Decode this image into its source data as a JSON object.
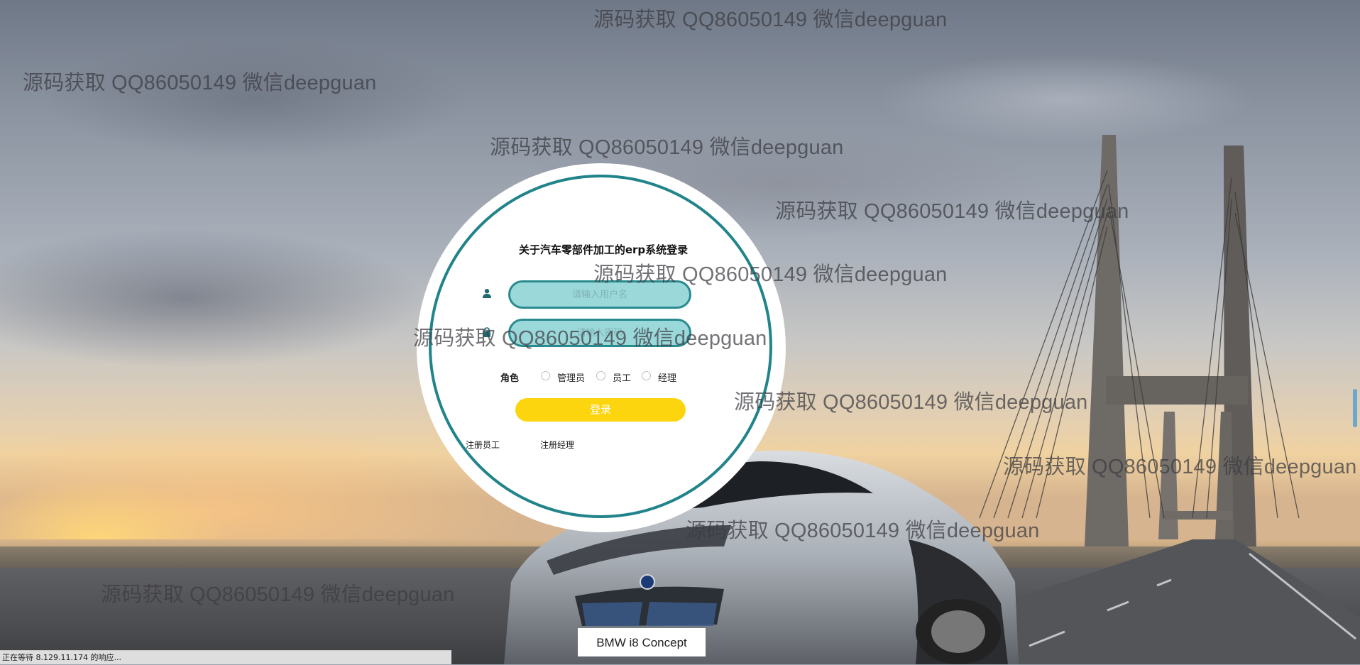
{
  "login": {
    "title": "关于汽车零部件加工的erp系统登录",
    "username_placeholder": "请输入用户名",
    "password_placeholder": "请输入密码",
    "role_label": "角色",
    "roles": [
      "管理员",
      "员工",
      "经理"
    ],
    "submit_label": "登录",
    "register_employee": "注册员工",
    "register_manager": "注册经理"
  },
  "car_plate": "BMW i8 Concept",
  "watermark_text": "源码获取 QQ86050149 微信deepguan",
  "status_bar": "正在等待 8.129.11.174 的响应...",
  "colors": {
    "accent_teal": "#21848a",
    "input_fill": "#9bd8da",
    "button_yellow": "#fcd50f"
  },
  "icons": {
    "username": "user-icon",
    "password": "lock-icon"
  }
}
